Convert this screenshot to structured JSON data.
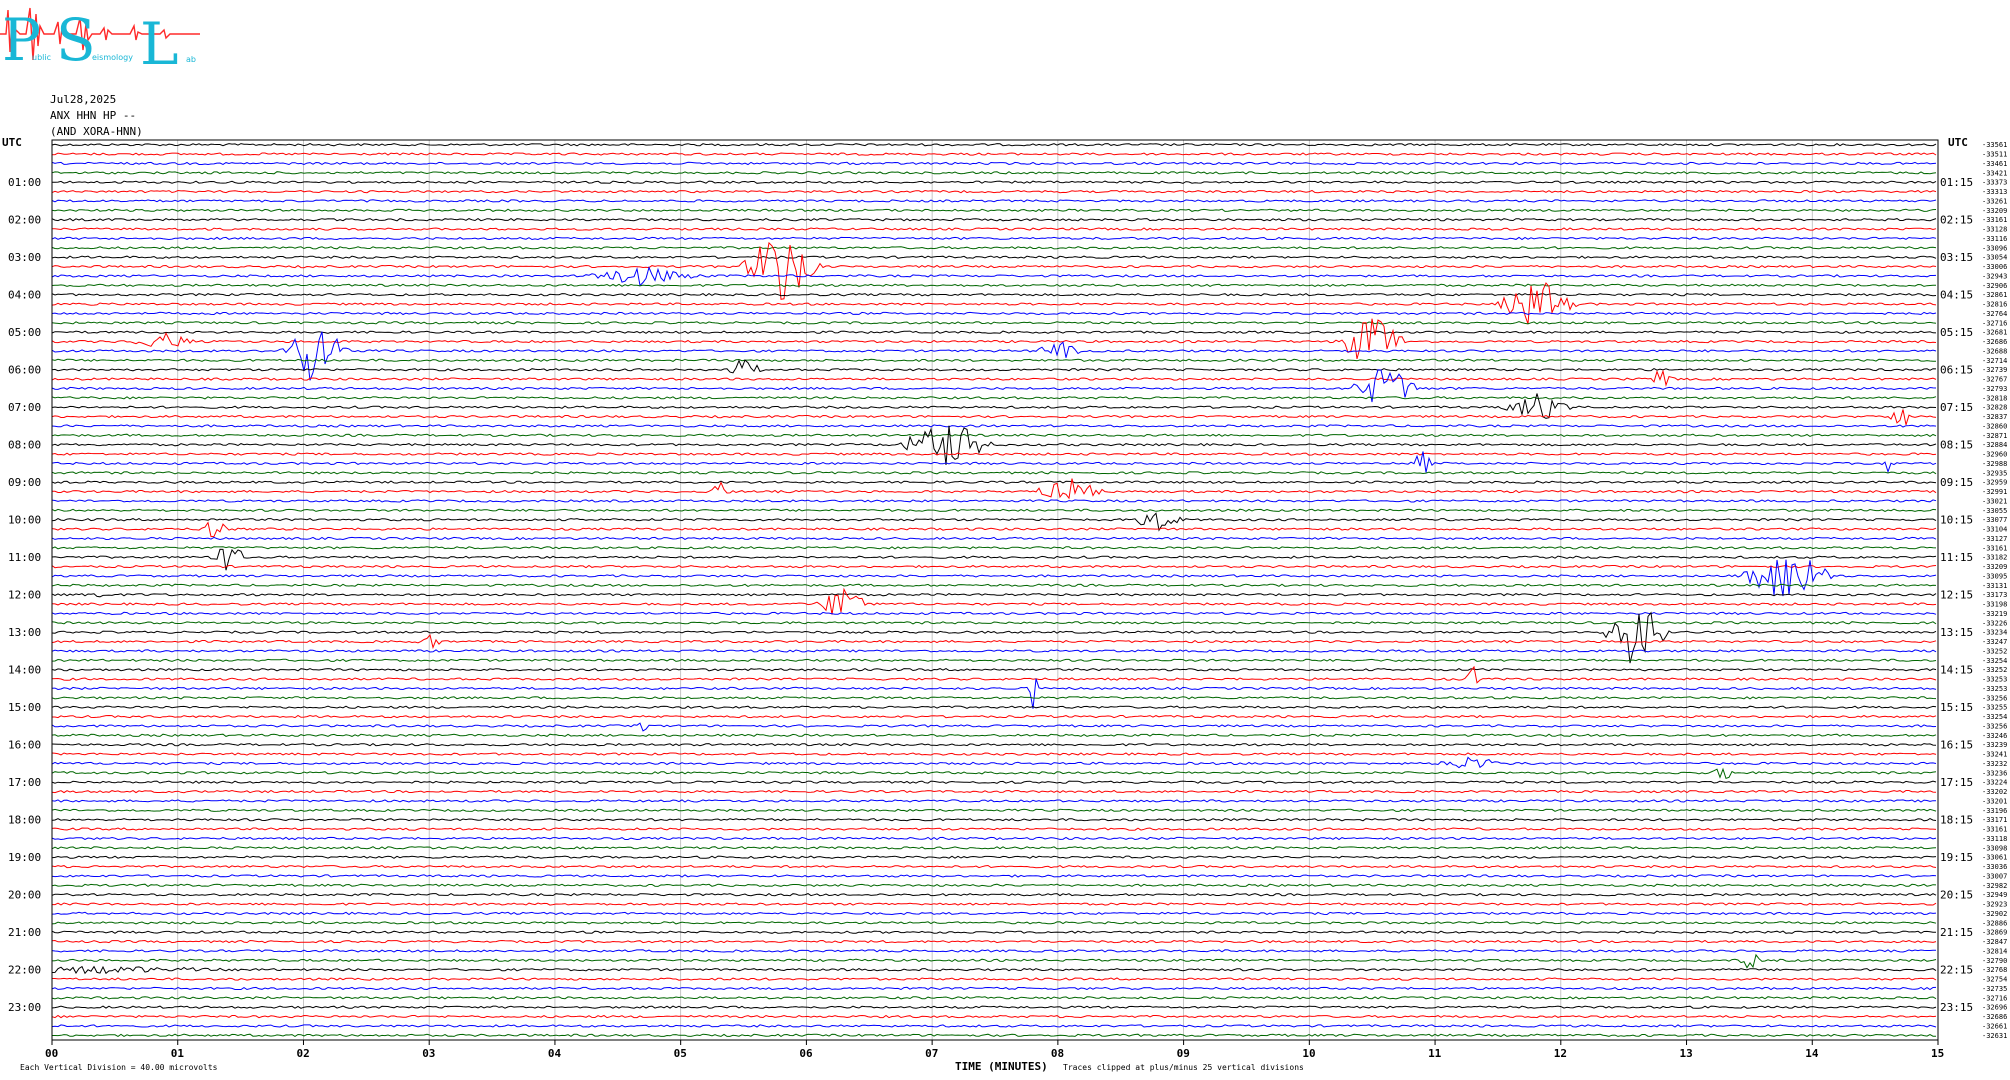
{
  "logo": {
    "letters": [
      "P",
      "S",
      "L"
    ],
    "small_words": [
      "ublic",
      "eismology",
      "ab"
    ],
    "colors": {
      "letters": "#19b7d6",
      "wave": "#ff2a2a"
    }
  },
  "header": {
    "date": "Jul28,2025",
    "station": "ANX HHN HP --",
    "network": "(AND XORA-HNN)"
  },
  "chart_data": {
    "type": "helicorder",
    "title": "",
    "left_axis_title": "UTC",
    "right_axis_title": "UTC",
    "xlabel": "TIME (MINUTES)",
    "x_ticks": [
      "00",
      "01",
      "02",
      "03",
      "04",
      "05",
      "06",
      "07",
      "08",
      "09",
      "10",
      "11",
      "12",
      "13",
      "14",
      "15"
    ],
    "xlim": [
      0,
      15
    ],
    "left_hour_labels": [
      "01:00",
      "02:00",
      "03:00",
      "04:00",
      "05:00",
      "06:00",
      "07:00",
      "08:00",
      "09:00",
      "10:00",
      "11:00",
      "12:00",
      "13:00",
      "14:00",
      "15:00",
      "16:00",
      "17:00",
      "18:00",
      "19:00",
      "20:00",
      "21:00",
      "22:00",
      "23:00"
    ],
    "right_hour_labels": [
      "01:15",
      "02:15",
      "03:15",
      "04:15",
      "05:15",
      "06:15",
      "07:15",
      "08:15",
      "09:15",
      "10:15",
      "11:15",
      "12:15",
      "13:15",
      "14:15",
      "15:15",
      "16:15",
      "17:15",
      "18:15",
      "19:15",
      "20:15",
      "21:15",
      "22:15",
      "23:15"
    ],
    "trace_colors": [
      "#000000",
      "#ff0000",
      "#0000ff",
      "#006600"
    ],
    "trace_count": 96,
    "trace_minutes": 15,
    "right_offsets": [
      "-33561",
      "-33511",
      "-33461",
      "-33421",
      "-33373",
      "-33313",
      "-33261",
      "-33209",
      "-33161",
      "-33128",
      "-33116",
      "-33096",
      "-33054",
      "-33006",
      "-32943",
      "-32906",
      "-32861",
      "-32816",
      "-32764",
      "-32716",
      "-32681",
      "-32686",
      "-32688",
      "-32714",
      "-32739",
      "-32767",
      "-32793",
      "-32818",
      "-32828",
      "-32837",
      "-32860",
      "-32871",
      "-32884",
      "-32960",
      "-32988",
      "-32935",
      "-32959",
      "-32991",
      "-33021",
      "-33055",
      "-33077",
      "-33104",
      "-33127",
      "-33161",
      "-33182",
      "-33209",
      "-33095",
      "-33131",
      "-33173",
      "-33198",
      "-33219",
      "-33226",
      "-33234",
      "-33247",
      "-33252",
      "-33254",
      "-33252",
      "-33253",
      "-33253",
      "-33256",
      "-33255",
      "-33254",
      "-33256",
      "-33246",
      "-33239",
      "-33241",
      "-33232",
      "-33236",
      "-33224",
      "-33202",
      "-33201",
      "-33196",
      "-33171",
      "-33161",
      "-33118",
      "-33098",
      "-33061",
      "-33036",
      "-33007",
      "-32982",
      "-32949",
      "-32923",
      "-32902",
      "-32886",
      "-32869",
      "-32847",
      "-32814",
      "-32790",
      "-32768",
      "-32754",
      "-32735",
      "-32716",
      "-32696",
      "-32686",
      "-32661",
      "-32631",
      "-32596"
    ],
    "events": [
      {
        "row": 13,
        "minute": 5.8,
        "amplitude": 2.6,
        "width": 0.35,
        "color_index": 0
      },
      {
        "row": 14,
        "minute": 4.7,
        "amplitude": 0.7,
        "width": 0.5,
        "color_index": 2
      },
      {
        "row": 17,
        "minute": 11.8,
        "amplitude": 1.8,
        "width": 0.35,
        "color_index": 2
      },
      {
        "row": 21,
        "minute": 0.9,
        "amplitude": 0.6,
        "width": 0.3,
        "color_index": 0
      },
      {
        "row": 22,
        "minute": 2.1,
        "amplitude": 2.4,
        "width": 0.3,
        "color_index": 2
      },
      {
        "row": 21,
        "minute": 10.5,
        "amplitude": 2.0,
        "width": 0.3,
        "color_index": 1
      },
      {
        "row": 22,
        "minute": 8.0,
        "amplitude": 0.8,
        "width": 0.2,
        "color_index": 2
      },
      {
        "row": 24,
        "minute": 5.5,
        "amplitude": 0.8,
        "width": 0.15,
        "color_index": 0
      },
      {
        "row": 26,
        "minute": 10.6,
        "amplitude": 1.6,
        "width": 0.3,
        "color_index": 2
      },
      {
        "row": 25,
        "minute": 12.8,
        "amplitude": 0.9,
        "width": 0.1,
        "color_index": 1
      },
      {
        "row": 28,
        "minute": 11.8,
        "amplitude": 1.0,
        "width": 0.3,
        "color_index": 0
      },
      {
        "row": 29,
        "minute": 14.7,
        "amplitude": 1.0,
        "width": 0.1,
        "color_index": 1
      },
      {
        "row": 32,
        "minute": 7.1,
        "amplitude": 1.8,
        "width": 0.4,
        "color_index": 0
      },
      {
        "row": 34,
        "minute": 10.9,
        "amplitude": 0.9,
        "width": 0.1,
        "color_index": 2
      },
      {
        "row": 34,
        "minute": 14.6,
        "amplitude": 0.8,
        "width": 0.1,
        "color_index": 2
      },
      {
        "row": 37,
        "minute": 8.1,
        "amplitude": 1.0,
        "width": 0.3,
        "color_index": 1
      },
      {
        "row": 37,
        "minute": 5.3,
        "amplitude": 0.8,
        "width": 0.1,
        "color_index": 1
      },
      {
        "row": 40,
        "minute": 8.8,
        "amplitude": 0.9,
        "width": 0.2,
        "color_index": 0
      },
      {
        "row": 41,
        "minute": 1.3,
        "amplitude": 1.2,
        "width": 0.1,
        "color_index": 1
      },
      {
        "row": 44,
        "minute": 1.4,
        "amplitude": 1.2,
        "width": 0.15,
        "color_index": 0
      },
      {
        "row": 46,
        "minute": 13.8,
        "amplitude": 2.0,
        "width": 0.4,
        "color_index": 2
      },
      {
        "row": 48,
        "minute": 0.3,
        "amplitude": 1.4,
        "width": 0.1,
        "color_index": 0
      },
      {
        "row": 49,
        "minute": 6.3,
        "amplitude": 1.4,
        "width": 0.25,
        "color_index": 1
      },
      {
        "row": 52,
        "minute": 12.6,
        "amplitude": 2.5,
        "width": 0.3,
        "color_index": 0
      },
      {
        "row": 53,
        "minute": 3.0,
        "amplitude": 0.8,
        "width": 0.1,
        "color_index": 1
      },
      {
        "row": 58,
        "minute": 7.8,
        "amplitude": 1.4,
        "width": 0.05,
        "color_index": 1
      },
      {
        "row": 57,
        "minute": 11.3,
        "amplitude": 1.2,
        "width": 0.05,
        "color_index": 2
      },
      {
        "row": 62,
        "minute": 4.7,
        "amplitude": 0.7,
        "width": 0.05,
        "color_index": 1
      },
      {
        "row": 66,
        "minute": 11.3,
        "amplitude": 0.5,
        "width": 0.3,
        "color_index": 0
      },
      {
        "row": 67,
        "minute": 13.3,
        "amplitude": 0.6,
        "width": 0.1,
        "color_index": 1
      },
      {
        "row": 87,
        "minute": 13.5,
        "amplitude": 0.7,
        "width": 0.1,
        "color_index": 3
      },
      {
        "row": 88,
        "minute": 0.3,
        "amplitude": 0.3,
        "width": 1.2,
        "color_index": 2
      }
    ]
  },
  "footer": {
    "division": "Each Vertical Division =   40.00 microvolts",
    "clipped": "Traces clipped at plus/minus 25 vertical divisions"
  }
}
